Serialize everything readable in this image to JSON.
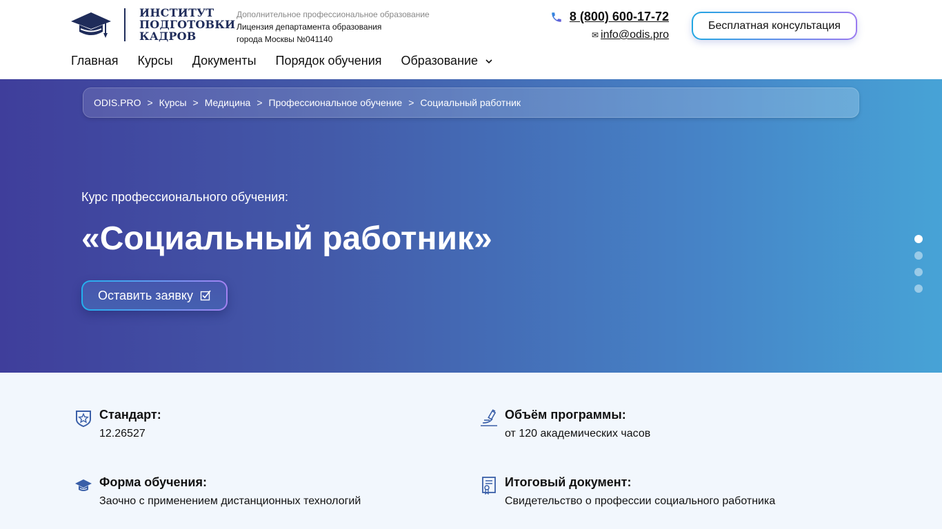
{
  "header": {
    "logo_lines": [
      "ИНСТИТУТ",
      "ПОДГОТОВКИ",
      "КАДРОВ"
    ],
    "license_lines": [
      "Дополнительное профессиональное образование",
      "Лицензия департамента образования",
      "города Москвы №041140"
    ],
    "phone": "8 (800) 600-17-72",
    "email": "info@odis.pro",
    "email_icon": "✉",
    "consult_label": "Бесплатная консультация",
    "nav": [
      "Главная",
      "Курсы",
      "Документы",
      "Порядок обучения",
      "Образование"
    ]
  },
  "hero": {
    "breadcrumb": [
      "ODIS.PRO",
      "Курсы",
      "Медицина",
      "Профессиональное обучение",
      "Социальный работник"
    ],
    "breadcrumb_sep": ">",
    "subtitle": "Курс профессионального обучения:",
    "title": "«Социальный работник»",
    "apply_label": "Оставить заявку",
    "slides_total": 4,
    "slide_active": 1
  },
  "info": {
    "items": [
      {
        "label": "Стандарт:",
        "value": "12.26527",
        "icon": "shield-star-icon"
      },
      {
        "label": "Объём программы:",
        "value": "от 120 академических часов",
        "icon": "microscope-icon"
      },
      {
        "label": "Форма обучения:",
        "value": "Заочно с применением дистанционных технологий",
        "icon": "graduation-cap-icon"
      },
      {
        "label": "Итоговый документ:",
        "value": "Свидетельство о профессии социального работника",
        "icon": "certificate-icon"
      }
    ]
  },
  "colors": {
    "brand_navy": "#1f2c5a",
    "hero_start": "#3f3e9b",
    "hero_end": "#47a3d6",
    "accent_blue": "#21a6e2",
    "accent_violet": "#9a7af0",
    "info_bg": "#f2f7fd",
    "icon_color": "#3a5fa8"
  }
}
